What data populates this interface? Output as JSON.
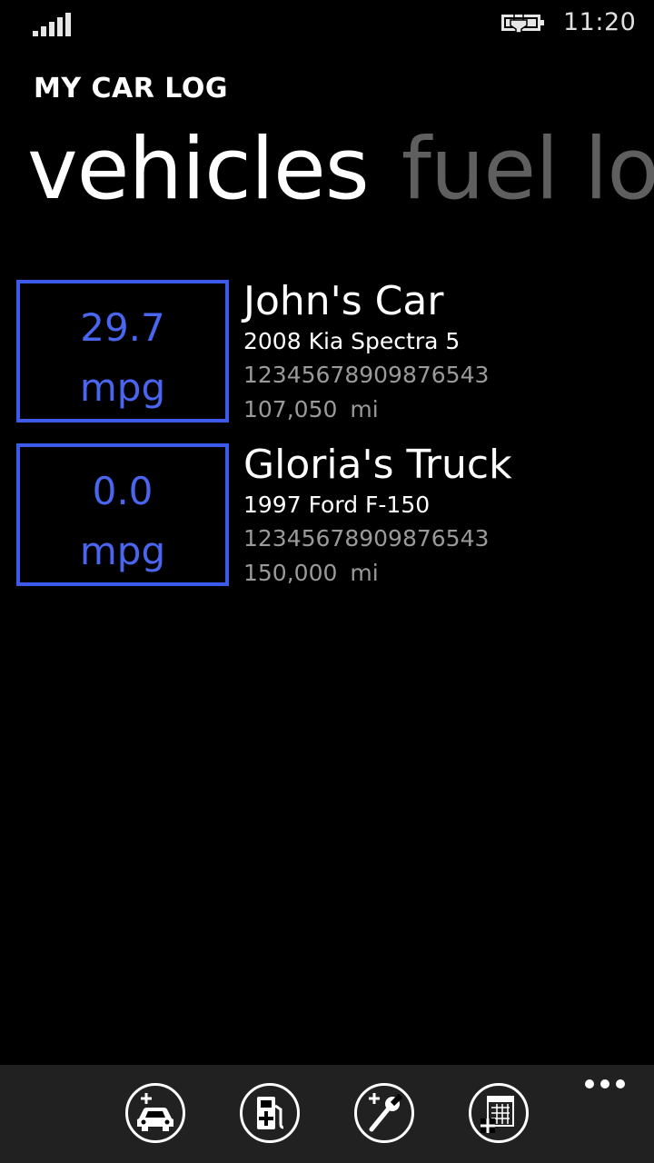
{
  "status_bar": {
    "time": "11:20",
    "signal_icon": "signal-strength-icon",
    "battery_icon": "battery-charging-icon"
  },
  "app": {
    "title": "MY CAR LOG"
  },
  "pivot": {
    "active": "vehicles",
    "next": "fuel log"
  },
  "vehicles": [
    {
      "mpg": "29.7",
      "mpg_unit": "mpg",
      "name": "John's Car",
      "model": "2008 Kia Spectra 5",
      "vin": "12345678909876543",
      "odometer": "107,050",
      "odometer_unit": "mi"
    },
    {
      "mpg": "0.0",
      "mpg_unit": "mpg",
      "name": "Gloria's Truck",
      "model": "1997 Ford F-150",
      "vin": "12345678909876543",
      "odometer": "150,000",
      "odometer_unit": "mi"
    }
  ],
  "app_bar": {
    "buttons": [
      "add-vehicle-icon",
      "add-fuel-icon",
      "add-service-icon",
      "add-event-icon"
    ],
    "more_icon": "more-ellipsis-icon"
  },
  "colors": {
    "accent": "#3d5bea",
    "background": "#000000",
    "app_bar": "#212121"
  }
}
